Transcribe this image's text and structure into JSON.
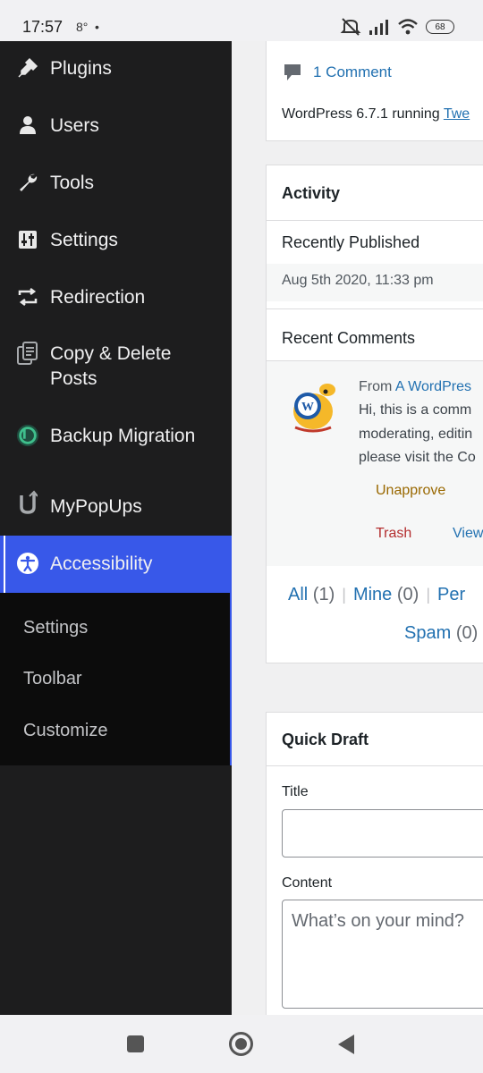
{
  "status_bar": {
    "time": "17:57",
    "temperature": "8°",
    "dot": "•",
    "battery": "68"
  },
  "sidebar": {
    "items": [
      {
        "label": "Plugins",
        "icon": "plugin-icon"
      },
      {
        "label": "Users",
        "icon": "user-icon"
      },
      {
        "label": "Tools",
        "icon": "wrench-icon"
      },
      {
        "label": "Settings",
        "icon": "settings-sliders-icon"
      },
      {
        "label": "Redirection",
        "icon": "redirect-arrows-icon"
      },
      {
        "label_line1": "Copy & Delete",
        "label_line2": "Posts",
        "icon": "copy-delete-icon"
      },
      {
        "label": "Backup Migration",
        "icon": "backup-migration-icon"
      },
      {
        "label": "MyPopUps",
        "icon": "mypopups-icon"
      },
      {
        "label": "Accessibility",
        "icon": "accessibility-icon",
        "active": true
      }
    ],
    "submenu": [
      "Settings",
      "Toolbar",
      "Customize"
    ],
    "active_color": "#3858e9"
  },
  "main": {
    "at_a_glance": {
      "comment_link": "1 Comment",
      "wp_version_prefix": "WordPress 6.7.1 running ",
      "theme_link": "Twe"
    },
    "activity": {
      "title": "Activity",
      "recently_published": "Recently Published",
      "published_date": "Aug 5th 2020, 11:33 pm",
      "recent_comments": "Recent Comments",
      "comment": {
        "from_prefix": "From ",
        "author_link": "A WordPres",
        "line1": "Hi, this is a comm",
        "line2": "moderating, editin",
        "line3": "please visit the Co",
        "actions": {
          "unapprove": "Unapprove",
          "trash": "Trash",
          "view": "View"
        }
      },
      "filters": {
        "all": "All",
        "all_count": "(1)",
        "mine": "Mine",
        "mine_count": "(0)",
        "pending": "Per",
        "spam": "Spam",
        "spam_count": "(0)",
        "separator": "|"
      }
    },
    "quick_draft": {
      "title": "Quick Draft",
      "title_label": "Title",
      "content_label": "Content",
      "content_placeholder": "What’s on your mind?"
    }
  }
}
